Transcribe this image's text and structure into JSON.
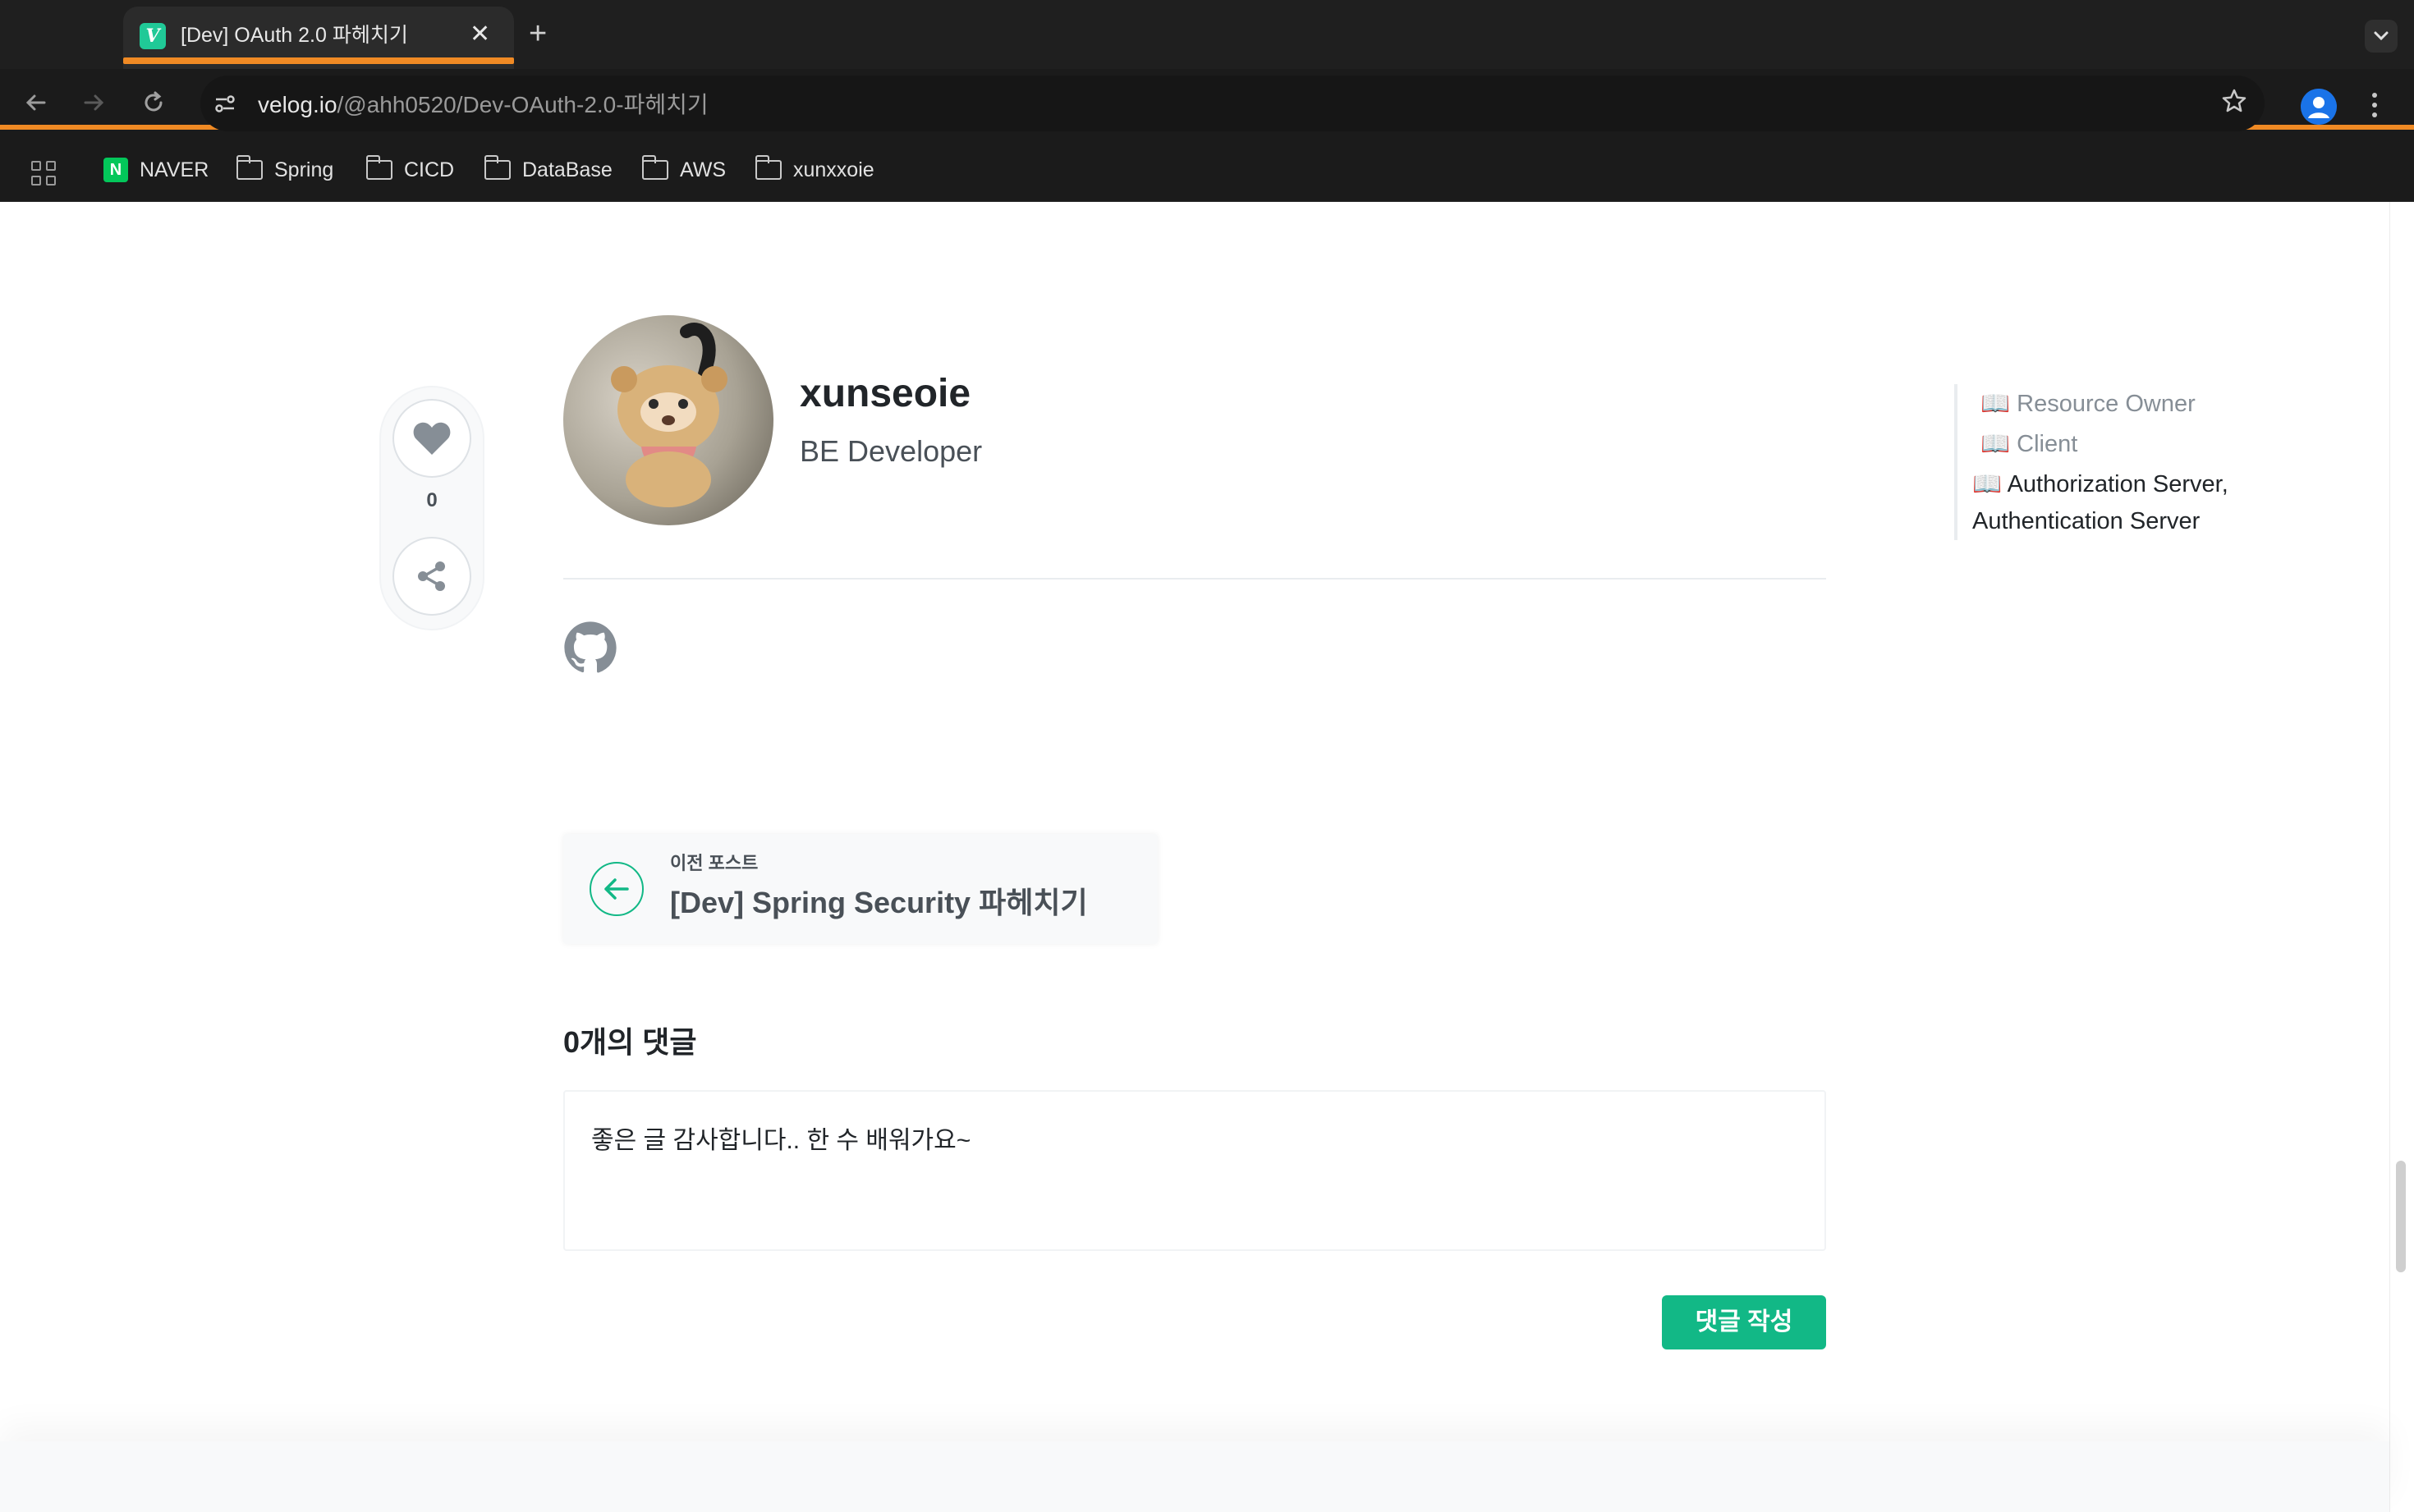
{
  "browser": {
    "tab_title": "[Dev] OAuth 2.0 파헤치기",
    "tab_close": "✕",
    "new_tab": "+",
    "favicon_letter": "V",
    "url_host": "velog.io",
    "url_path": "/@ahh0520/Dev-OAuth-2.0-파헤치기",
    "icons": [
      "back-arrow-icon",
      "forward-arrow-icon",
      "reload-icon",
      "site-info-icon",
      "bookmark-star-icon",
      "profile-icon",
      "more-menu-icon"
    ],
    "accent_color": "#f08a24"
  },
  "bookmarks": [
    {
      "label": "NAVER",
      "icon": "naver-icon"
    },
    {
      "label": "Spring",
      "icon": "folder-icon"
    },
    {
      "label": "CICD",
      "icon": "folder-icon"
    },
    {
      "label": "DataBase",
      "icon": "folder-icon"
    },
    {
      "label": "AWS",
      "icon": "folder-icon"
    },
    {
      "label": "xunxxoie",
      "icon": "folder-icon"
    }
  ],
  "post": {
    "like_count": "0",
    "author": {
      "name": "xunseoie",
      "description": "BE Developer"
    },
    "previous_post": {
      "label": "이전 포스트",
      "title": "[Dev] Spring Security 파헤치기"
    },
    "comments": {
      "count_label": "0개의 댓글",
      "input_value": "좋은 글 감사합니다.. 한 수 배워가요~",
      "submit_label": "댓글 작성"
    },
    "toc": [
      {
        "label": "📖 Resource Owner",
        "active": false
      },
      {
        "label": "📖 Client",
        "active": false
      },
      {
        "label": "📖 Authorization Server, Authentication Server",
        "active": true
      }
    ],
    "brand_color": "#12b886"
  }
}
